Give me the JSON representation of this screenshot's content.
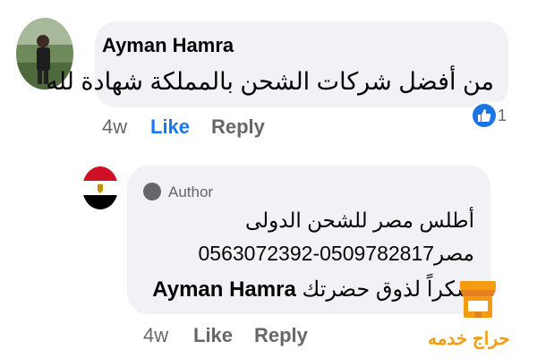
{
  "comment": {
    "author_name": "Ayman Hamra",
    "text": "من أفضل شركات الشحن بالمملكة شهادة لله",
    "timestamp": "4w",
    "like_label": "Like",
    "reply_label": "Reply",
    "reaction_count": "1",
    "reaction_icon": "thumbs-up-icon",
    "like_color": "#1877f2"
  },
  "reply": {
    "author_badge": "Author",
    "line_1": "أطلس مصر للشحن الدولى",
    "line_2": "مصر0509782817-0563072392",
    "mention": "Ayman Hamra",
    "line_3_text": "شكراً لذوق حضرتك",
    "timestamp": "4w",
    "like_label": "Like",
    "reply_label": "Reply",
    "avatar_icon": "egypt-flag-icon"
  },
  "watermark": {
    "text": "حراج خدمه",
    "color": "#f39c12",
    "icon": "storefront-icon"
  }
}
